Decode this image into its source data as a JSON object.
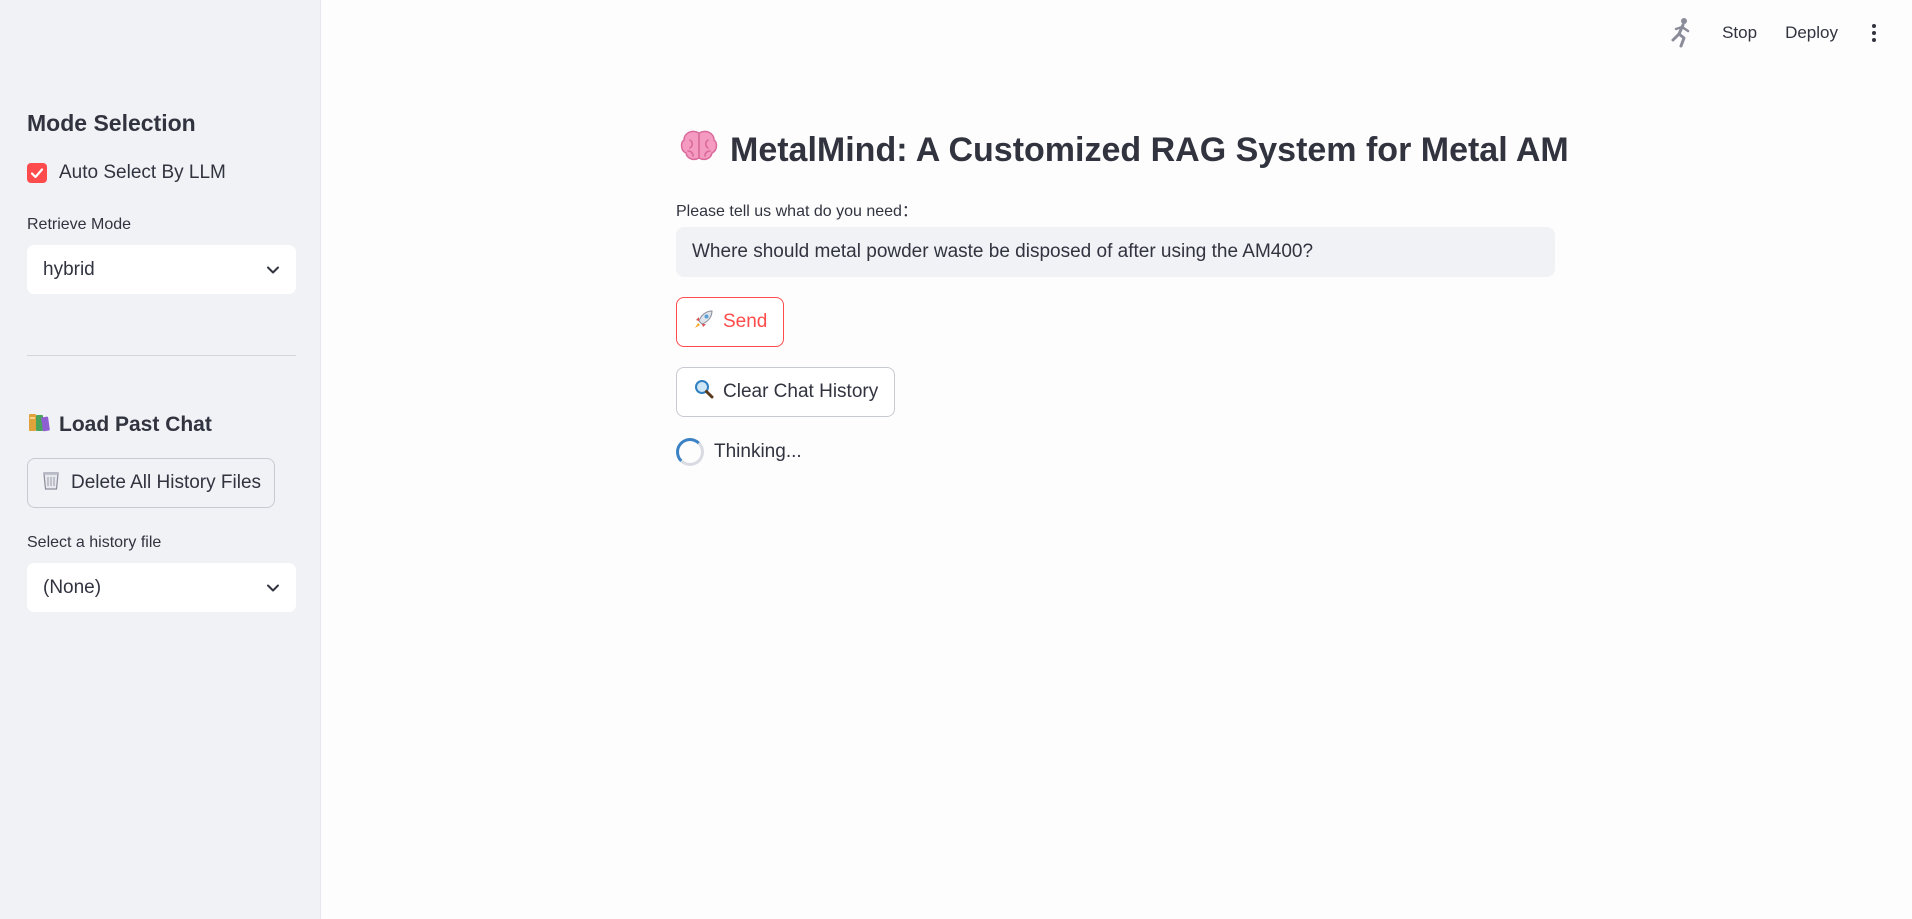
{
  "header": {
    "stop_label": "Stop",
    "deploy_label": "Deploy"
  },
  "sidebar": {
    "mode_heading": "Mode Selection",
    "auto_select_label": "Auto Select By LLM",
    "auto_select_checked": true,
    "retrieve_mode_label": "Retrieve Mode",
    "retrieve_mode_value": "hybrid",
    "load_heading": "Load Past Chat",
    "delete_button_label": "Delete All History Files",
    "history_label": "Select a history file",
    "history_value": "(None)"
  },
  "main": {
    "title": "MetalMind: A Customized RAG System for Metal AM",
    "input_label": "Please tell us what do you need：",
    "input_value": "Where should metal powder waste be disposed of after using the AM400?",
    "send_label": "Send",
    "clear_label": "Clear Chat History",
    "status_text": "Thinking..."
  },
  "colors": {
    "accent": "#ff4b4b",
    "sidebar_bg": "#f0f2f6",
    "text": "#31333f",
    "spinner": "#3b82c4"
  },
  "icons": {
    "title": "brain-icon",
    "load": "books-icon",
    "delete": "wastebasket-icon",
    "send": "rocket-icon",
    "clear": "magnifier-icon",
    "running": "running-man-icon",
    "menu": "kebab-menu-icon"
  }
}
